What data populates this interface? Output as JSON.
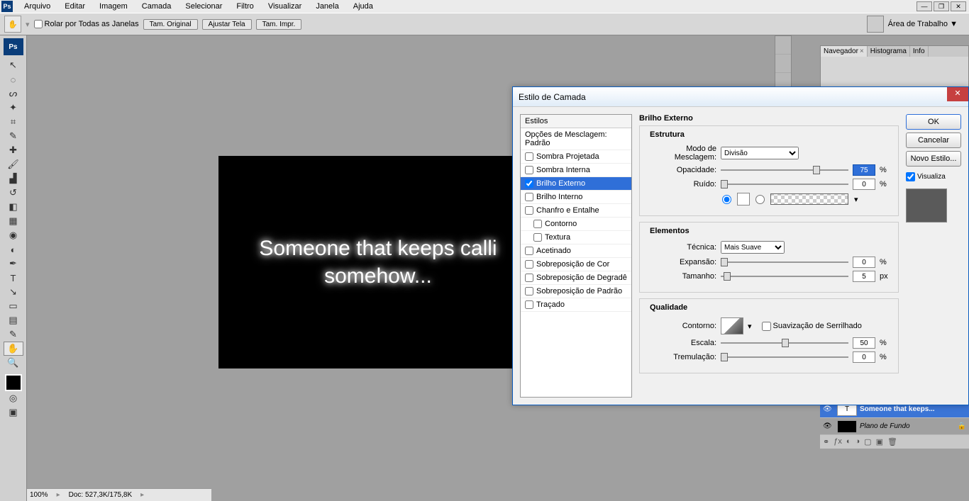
{
  "menu": {
    "items": [
      "Arquivo",
      "Editar",
      "Imagem",
      "Camada",
      "Selecionar",
      "Filtro",
      "Visualizar",
      "Janela",
      "Ajuda"
    ]
  },
  "optbar": {
    "scroll_all": "Rolar por Todas as Janelas",
    "btn_actual": "Tam. Original",
    "btn_fit": "Ajustar Tela",
    "btn_print": "Tam. Impr.",
    "workspace": "Área de Trabalho ▼"
  },
  "canvas": {
    "line1": "Someone that keeps calli",
    "line2": "somehow..."
  },
  "status": {
    "zoom": "100%",
    "doc": "Doc: 527,3K/175,8K"
  },
  "nav": {
    "tab1": "Navegador",
    "tab2": "Histograma",
    "tab3": "Info"
  },
  "layers": {
    "row1": "Someone that keeps...",
    "row2": "Plano de Fundo"
  },
  "dialog": {
    "title": "Estilo de Camada",
    "styles_hdr": "Estilos",
    "blend_opts": "Opções de Mesclagem: Padrão",
    "s_drop": "Sombra Projetada",
    "s_inner": "Sombra Interna",
    "s_outerglow": "Brilho Externo",
    "s_innerglow": "Brilho Interno",
    "s_bevel": "Chanfro e Entalhe",
    "s_contour": "Contorno",
    "s_texture": "Textura",
    "s_satin": "Acetinado",
    "s_color": "Sobreposição de Cor",
    "s_grad": "Sobreposição de Degradê",
    "s_pattern": "Sobreposição de Padrão",
    "s_stroke": "Traçado",
    "panel_title": "Brilho Externo",
    "grp_struct": "Estrutura",
    "lbl_blend": "Modo de Mesclagem:",
    "val_blend": "Divisão",
    "lbl_opacity": "Opacidade:",
    "val_opacity": "75",
    "lbl_noise": "Ruído:",
    "val_noise": "0",
    "grp_elem": "Elementos",
    "lbl_tech": "Técnica:",
    "val_tech": "Mais Suave",
    "lbl_spread": "Expansão:",
    "val_spread": "0",
    "lbl_size": "Tamanho:",
    "val_size": "5",
    "grp_qual": "Qualidade",
    "lbl_contour": "Contorno:",
    "lbl_anti": "Suavização de Serrilhado",
    "lbl_range": "Escala:",
    "val_range": "50",
    "lbl_jitter": "Tremulação:",
    "val_jitter": "0",
    "pct": "%",
    "px": "px",
    "btn_ok": "OK",
    "btn_cancel": "Cancelar",
    "btn_new": "Novo Estilo...",
    "chk_preview": "Visualiza"
  }
}
